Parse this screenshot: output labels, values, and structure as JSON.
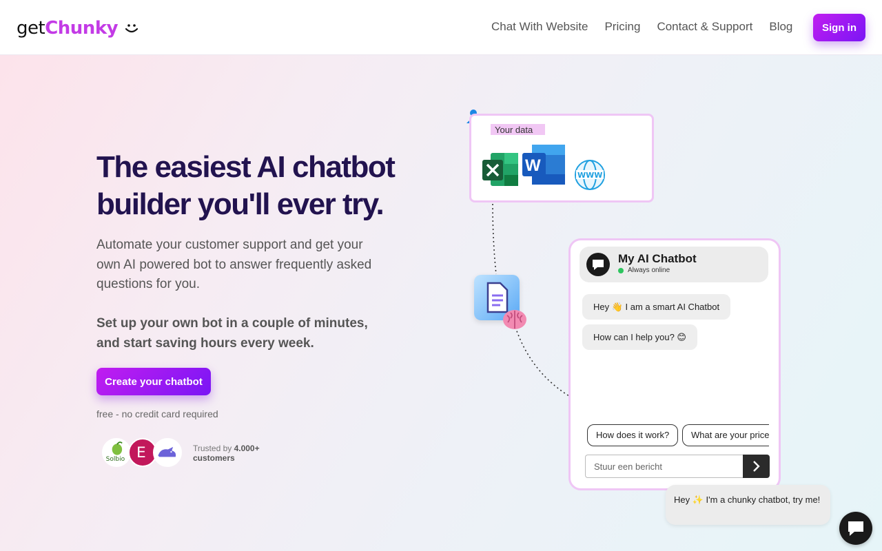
{
  "header": {
    "logo_get": "get",
    "logo_chunky": "Chunky",
    "nav": [
      "Chat With Website",
      "Pricing",
      "Contact & Support",
      "Blog"
    ],
    "signin_label": "Sign in"
  },
  "hero": {
    "title_line1": "The easiest AI chatbot",
    "title_line2": "builder you'll ever try.",
    "subtitle": "Automate your customer support and get your own AI powered bot to answer frequently asked questions for you.",
    "subtitle2": "Set up your own bot in a couple of minutes, and start saving hours every week.",
    "cta_label": "Create your chatbot",
    "cta_note": "free - no credit card required",
    "trust_prefix": "Trusted by ",
    "trust_count": "4.000+",
    "trust_suffix": "customers",
    "customer_logos": [
      "Solbio",
      "E",
      "rhino"
    ]
  },
  "illustration": {
    "data_label": "Your data",
    "data_icons": [
      "excel-icon",
      "word-icon",
      "www-globe-icon"
    ],
    "chatbot": {
      "title": "My AI Chatbot",
      "status": "Always online",
      "messages": [
        "Hey 👋 I am a smart AI Chatbot",
        "How can I help you? 😊"
      ],
      "suggestions": [
        "How does it work?",
        "What are your prices?"
      ],
      "input_placeholder": "Stuur een bericht"
    }
  },
  "widget": {
    "promo_text": "Hey ✨ I'm a chunky chatbot, try me!"
  },
  "colors": {
    "brand_purple": "#c33be6",
    "button_gradient_start": "#c11df0",
    "button_gradient_end": "#7a16f5",
    "title_color": "#22134f",
    "online_green": "#2ec45e"
  }
}
